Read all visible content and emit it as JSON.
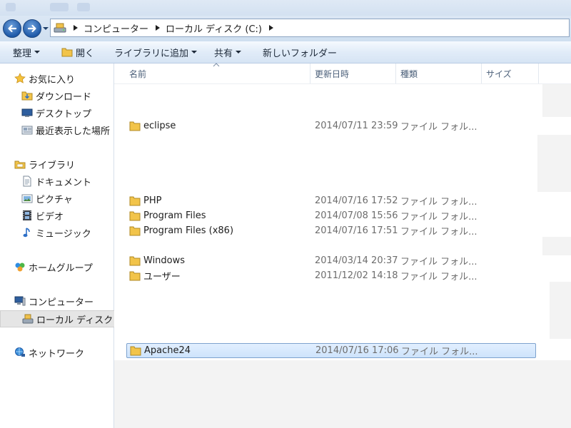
{
  "colors": {
    "selection_bg": "#cde3fb",
    "selection_border": "#7da2ce",
    "folder_yellow": "#f2c44a",
    "nav_button_blue": "#1f5aa8"
  },
  "navigation": {
    "back_icon": "back-arrow-icon",
    "forward_icon": "forward-arrow-icon",
    "history_icon": "chevron-down-icon"
  },
  "address": {
    "drive_icon": "drive-icon",
    "crumbs": [
      "コンピューター",
      "ローカル ディスク (C:)"
    ]
  },
  "toolbar": {
    "organize": "整理",
    "open": "開く",
    "add_to_library": "ライブラリに追加",
    "share": "共有",
    "new_folder": "新しいフォルダー"
  },
  "sidebar": {
    "favorites": {
      "label": "お気に入り",
      "icon": "star-icon"
    },
    "downloads": {
      "label": "ダウンロード",
      "icon": "download-folder-icon"
    },
    "desktop": {
      "label": "デスクトップ",
      "icon": "desktop-icon"
    },
    "recent": {
      "label": "最近表示した場所",
      "icon": "recent-places-icon"
    },
    "libraries": {
      "label": "ライブラリ",
      "icon": "library-icon"
    },
    "documents": {
      "label": "ドキュメント",
      "icon": "document-icon"
    },
    "pictures": {
      "label": "ピクチャ",
      "icon": "picture-icon"
    },
    "videos": {
      "label": "ビデオ",
      "icon": "film-icon"
    },
    "music": {
      "label": "ミュージック",
      "icon": "music-note-icon"
    },
    "homegroup": {
      "label": "ホームグループ",
      "icon": "homegroup-icon"
    },
    "computer": {
      "label": "コンピューター",
      "icon": "computer-icon"
    },
    "local_disk": {
      "label": "ローカル ディスク (C:)",
      "icon": "drive-icon"
    },
    "network": {
      "label": "ネットワーク",
      "icon": "network-icon"
    }
  },
  "columns": {
    "name": "名前",
    "date": "更新日時",
    "type": "種類",
    "size": "サイズ"
  },
  "files": [
    {
      "name": "eclipse",
      "date": "2014/07/11 23:59",
      "type": "ファイル フォル..."
    },
    {
      "name": "PHP",
      "date": "2014/07/16 17:52",
      "type": "ファイル フォル..."
    },
    {
      "name": "Program Files",
      "date": "2014/07/08 15:56",
      "type": "ファイル フォル..."
    },
    {
      "name": "Program Files (x86)",
      "date": "2014/07/16 17:51",
      "type": "ファイル フォル..."
    },
    {
      "name": "Windows",
      "date": "2014/03/14 20:37",
      "type": "ファイル フォル..."
    },
    {
      "name": "ユーザー",
      "date": "2011/12/02 14:18",
      "type": "ファイル フォル..."
    },
    {
      "name": "Apache24",
      "date": "2014/07/16 17:06",
      "type": "ファイル フォル...",
      "selected": true
    }
  ]
}
